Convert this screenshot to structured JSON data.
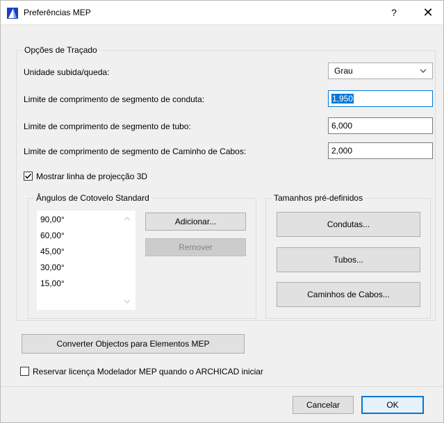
{
  "window": {
    "title": "Preferências MEP",
    "help_glyph": "?",
    "close_glyph": "✕"
  },
  "routing": {
    "group_title": "Opções de Traçado",
    "rise_fall_label": "Unidade subida/queda:",
    "rise_fall_value": "Grau",
    "duct_label": "Limite de comprimento de segmento de conduta:",
    "duct_value": "1,950",
    "pipe_label": "Limite de comprimento de segmento de tubo:",
    "pipe_value": "6,000",
    "cable_label": "Limite de comprimento de segmento de Caminho de Cabos:",
    "cable_value": "2,000",
    "show_3d_label": "Mostrar linha de projecção 3D",
    "show_3d_checked": true
  },
  "elbows": {
    "group_title": "Ângulos de Cotovelo Standard",
    "items": [
      "90,00°",
      "60,00°",
      "45,00°",
      "30,00°",
      "15,00°"
    ],
    "add_label": "Adicionar...",
    "remove_label": "Remover"
  },
  "presets": {
    "group_title": "Tamanhos pré-definidos",
    "ducts_label": "Condutas...",
    "pipes_label": "Tubos...",
    "cables_label": "Caminhos de Cabos..."
  },
  "convert_label": "Converter Objectos para Elementos MEP",
  "reserve_license_label": "Reservar licença Modelador MEP quando o ARCHICAD iniciar",
  "reserve_license_checked": false,
  "footer": {
    "cancel_label": "Cancelar",
    "ok_label": "OK"
  },
  "colors": {
    "accent": "#0078d7",
    "dialog_bg": "#f0f0f0"
  }
}
